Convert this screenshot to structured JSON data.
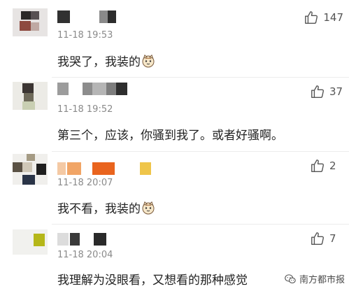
{
  "comments": [
    {
      "time": "11-18 19:53",
      "text": "我哭了，我装的",
      "has_emoji": true,
      "likes": "147"
    },
    {
      "time": "11-18 19:52",
      "text": "第三个，应该，你骚到我了。或者好骚啊。",
      "has_emoji": false,
      "likes": "37"
    },
    {
      "time": "11-18 20:07",
      "text": "我不看，我装的",
      "has_emoji": true,
      "likes": "2"
    },
    {
      "time": "11-18 20:04",
      "text": "我理解为没眼看，又想看的那种感觉",
      "has_emoji": false,
      "likes": "7"
    }
  ],
  "watermark": {
    "text": "南方都市报"
  },
  "colors": {
    "time": "#8a8a8a",
    "text": "#222222",
    "like_icon": "#555555",
    "divider": "#ececec"
  },
  "icons": {
    "like": "thumbs-up-icon",
    "emoji": "cat-face-emoji-icon",
    "watermark": "wechat-official-account-icon"
  }
}
